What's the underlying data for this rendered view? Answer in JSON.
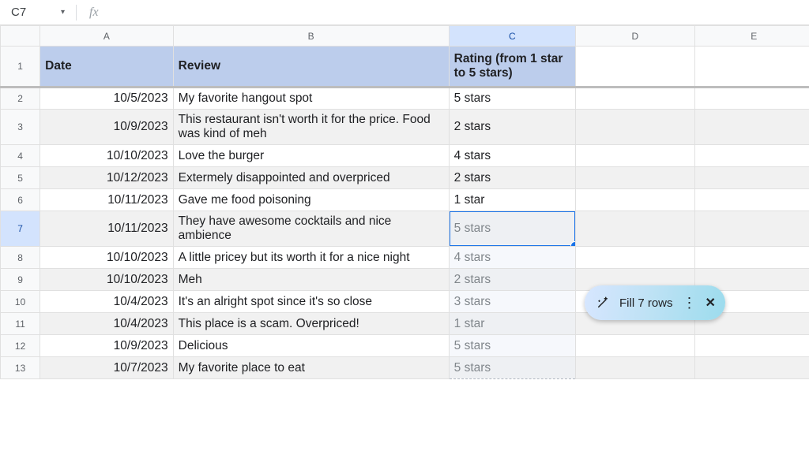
{
  "namebox": {
    "value": "C7",
    "formula": ""
  },
  "fx_symbol": "fx",
  "columns": [
    "A",
    "B",
    "C",
    "D",
    "E"
  ],
  "row_numbers": [
    "1",
    "2",
    "3",
    "4",
    "5",
    "6",
    "7",
    "8",
    "9",
    "10",
    "11",
    "12",
    "13"
  ],
  "selected": {
    "col": "C",
    "row": "7"
  },
  "headers": {
    "A": "Date",
    "B": "Review",
    "C": "Rating (from 1 star to 5 stars)",
    "D": "",
    "E": ""
  },
  "rows": [
    {
      "date": "10/5/2023",
      "review": "My favorite hangout spot",
      "rating": "5 stars",
      "ghost": false
    },
    {
      "date": "10/9/2023",
      "review": "This restaurant isn't worth it for the price. Food was kind of meh",
      "rating": "2 stars",
      "ghost": false
    },
    {
      "date": "10/10/2023",
      "review": "Love the burger",
      "rating": "4 stars",
      "ghost": false
    },
    {
      "date": "10/12/2023",
      "review": "Extermely disappointed and overpriced",
      "rating": "2 stars",
      "ghost": false
    },
    {
      "date": "10/11/2023",
      "review": "Gave me food poisoning",
      "rating": "1 star",
      "ghost": false
    },
    {
      "date": "10/11/2023",
      "review": "They have awesome cocktails and nice ambience",
      "rating": "5 stars",
      "ghost": true,
      "active": true
    },
    {
      "date": "10/10/2023",
      "review": "A little pricey but its worth it for a nice night",
      "rating": "4 stars",
      "ghost": true
    },
    {
      "date": "10/10/2023",
      "review": "Meh",
      "rating": "2 stars",
      "ghost": true
    },
    {
      "date": "10/4/2023",
      "review": "It's an alright spot since it's so close",
      "rating": "3 stars",
      "ghost": true
    },
    {
      "date": "10/4/2023",
      "review": "This place is a scam. Overpriced!",
      "rating": "1 star",
      "ghost": true
    },
    {
      "date": "10/9/2023",
      "review": "Delicious",
      "rating": "5 stars",
      "ghost": true
    },
    {
      "date": "10/7/2023",
      "review": "My favorite place to eat",
      "rating": "5 stars",
      "ghost": true
    }
  ],
  "smartfill": {
    "label": "Fill 7 rows"
  }
}
